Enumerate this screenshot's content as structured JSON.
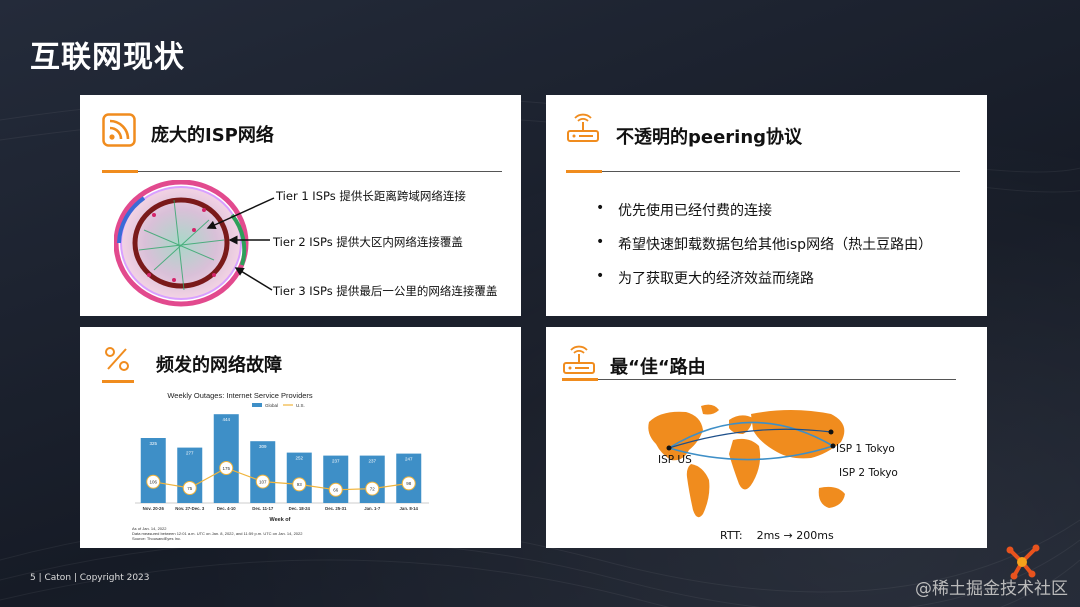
{
  "slide": {
    "title": "互联网现状",
    "footer": "5 | Caton | Copyright 2023",
    "watermark": "@稀土掘金技术社区"
  },
  "cards": {
    "isp": {
      "title": "庞大的ISP网络",
      "tiers": [
        "Tier 1 ISPs 提供长距离跨域网络连接",
        "Tier 2 ISPs 提供大区内网络连接覆盖",
        "Tier 3 ISPs 提供最后一公里的网络连接覆盖"
      ]
    },
    "peering": {
      "title": "不透明的peering协议",
      "bullets": [
        "优先使用已经付费的连接",
        "希望快速卸载数据包给其他isp网络（热土豆路由）",
        "为了获取更大的经济效益而绕路"
      ]
    },
    "outages": {
      "title": "频发的网络故障"
    },
    "routing": {
      "title": "最“佳“路由",
      "labels": {
        "us": "ISP US",
        "tokyo1": "ISP 1 Tokyo",
        "tokyo2": "ISP 2 Tokyo"
      },
      "rtt": "RTT:    2ms → 200ms"
    }
  },
  "chart_data": {
    "type": "bar",
    "title": "Weekly Outages: Internet Service Providers",
    "legend": [
      "Global",
      "U.S."
    ],
    "categories": [
      "Nov. 20-26",
      "Nov. 27-Dec. 3",
      "Dec. 4-10",
      "Dec. 11-17",
      "Dec. 18-24",
      "Dec. 25-31",
      "Jan. 1-7",
      "Jan. 8-14"
    ],
    "series": [
      {
        "name": "Global",
        "type": "bar",
        "values": [
          325,
          277,
          444,
          309,
          252,
          237,
          237,
          247
        ]
      },
      {
        "name": "U.S.",
        "type": "line",
        "values": [
          106,
          75,
          175,
          107,
          93,
          66,
          72,
          98
        ]
      }
    ],
    "xlabel": "Week of",
    "ylim": [
      0,
      460
    ],
    "notes": [
      "As of Jan. 14, 2022",
      "Data measured between 12:01 a.m. UTC on Jan. 8, 2022, and 11:59 p.m. UTC on Jan. 14, 2022",
      "Source: ThousandEyes Inc."
    ],
    "colors": {
      "bar": "#3e8fc7",
      "line": "#f0b43c"
    }
  }
}
